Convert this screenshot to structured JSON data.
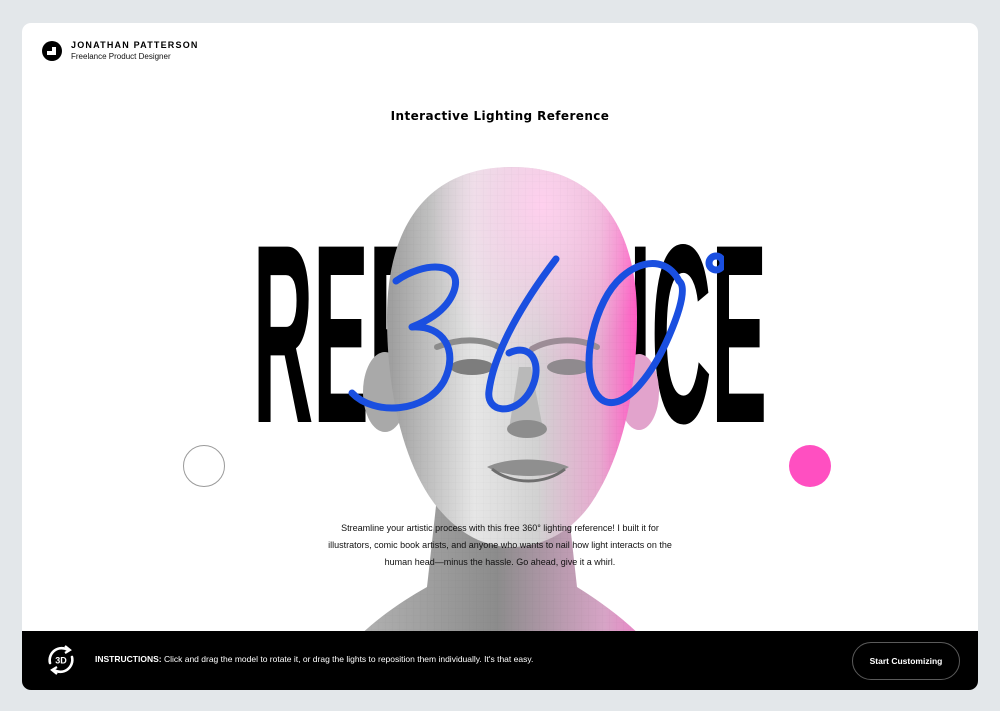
{
  "header": {
    "name": "JONATHAN PATTERSON",
    "subtitle": "Freelance Product Designer"
  },
  "hero": {
    "title": "Interactive Lighting Reference",
    "big_word": "REFERENCE",
    "scribble": "360°",
    "description_line1": "Streamline your artistic process with this free 360° lighting reference! I built it for",
    "description_line2": "illustrators, comic book artists, and anyone who wants to nail how light interacts on the",
    "description_line3": "human head—minus the hassle. Go ahead, give it a whirl."
  },
  "footer": {
    "icon_label": "3D",
    "instructions_label": "INSTRUCTIONS:",
    "instructions_text": " Click and drag the model to rotate it, or drag the lights to reposition them individually. It's that easy.",
    "cta_label": "Start Customizing"
  },
  "colors": {
    "accent_pink": "#ff4fc1",
    "scribble_blue": "#1a4fe0",
    "bar": "#000000",
    "background": "#e3e7ea"
  },
  "icons": [
    "logo-icon",
    "rotate-3d-icon"
  ]
}
